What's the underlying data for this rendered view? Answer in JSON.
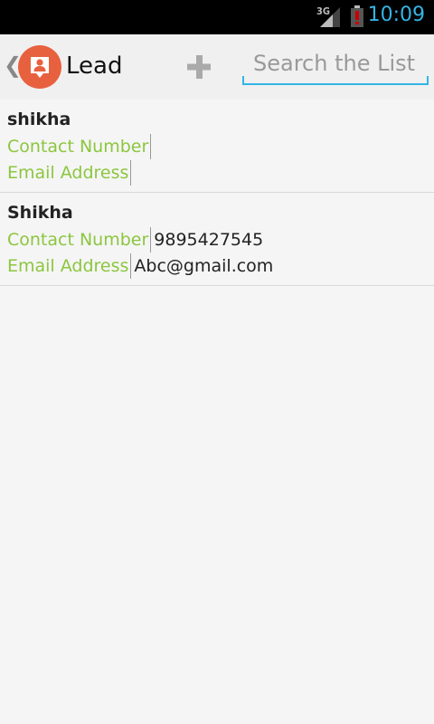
{
  "status_bar": {
    "network": "3G",
    "time": "10:09",
    "time_color": "#33b5e5",
    "battery_alert_color": "#cc0000"
  },
  "action_bar": {
    "title": "Lead",
    "icon": "lead-person-icon",
    "icon_color": "#e8613f",
    "add_icon": "plus-icon",
    "search_placeholder": "Search the List",
    "search_value": ""
  },
  "leads": [
    {
      "name": "shikha",
      "contact_label": "Contact Number",
      "contact_value": "",
      "email_label": "Email Address",
      "email_value": ""
    },
    {
      "name": "Shikha",
      "contact_label": "Contact Number",
      "contact_value": "9895427545",
      "email_label": "Email Address",
      "email_value": "Abc@gmail.com"
    }
  ],
  "colors": {
    "accent": "#33b5e5",
    "label_green": "#8cc63f"
  }
}
